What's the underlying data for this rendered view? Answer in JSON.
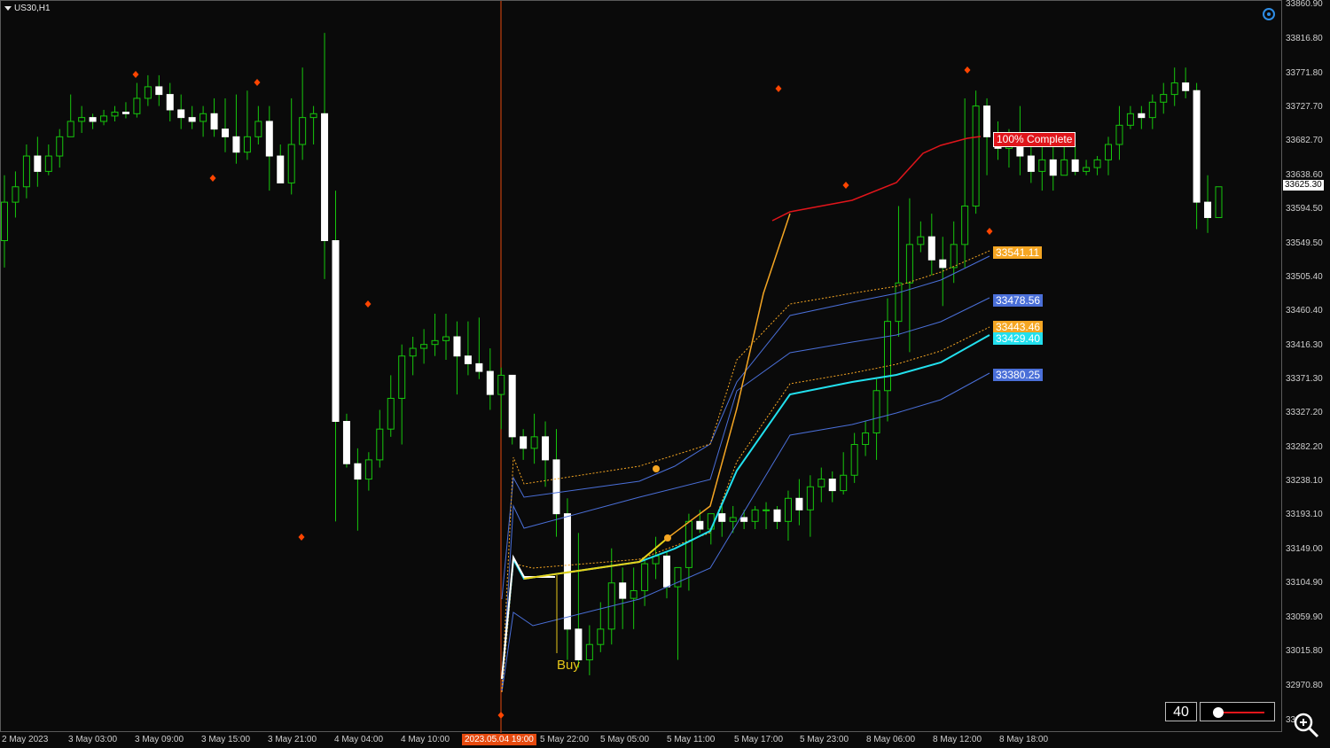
{
  "chart": {
    "symbol": "US30,H1",
    "current_price": "33625.30",
    "price_labels": [
      "33860.90",
      "33816.80",
      "33771.80",
      "33727.70",
      "33682.70",
      "33638.60",
      "33594.50",
      "33549.50",
      "33505.40",
      "33460.40",
      "33416.30",
      "33371.30",
      "33327.20",
      "33282.20",
      "33238.10",
      "33193.10",
      "33149.00",
      "33104.90",
      "33059.90",
      "33015.80",
      "32970.80",
      "33"
    ],
    "time_labels": [
      "2 May 2023",
      "3 May 03:00",
      "3 May 09:00",
      "3 May 15:00",
      "3 May 21:00",
      "4 May 04:00",
      "4 May 10:00",
      "5 May 22:00",
      "5 May 05:00",
      "5 May 11:00",
      "5 May 17:00",
      "5 May 23:00",
      "8 May 06:00",
      "8 May 12:00",
      "8 May 18:00"
    ],
    "highlighted_date": "2023.05.04 19:00",
    "complete_label": "100% Complete",
    "buy_label": "Buy",
    "levels": [
      {
        "value": "33541.11",
        "bg": "#f5a623",
        "fg": "#ffffff"
      },
      {
        "value": "33478.56",
        "bg": "#4a6fd8",
        "fg": "#ffffff"
      },
      {
        "value": "33443.46",
        "bg": "#f5a623",
        "fg": "#ffffff"
      },
      {
        "value": "33429.40",
        "bg": "#22e0ee",
        "fg": "#ffffff"
      },
      {
        "value": "33380.25",
        "bg": "#4a6fd8",
        "fg": "#ffffff"
      }
    ],
    "period_value": "40",
    "colors": {
      "bull": "#16c60c",
      "bear": "#ffffff",
      "vwap": "#22e0ee",
      "band": "#4a6fd8",
      "band_orange": "#f5a623",
      "complete": "#e0151b",
      "marker": "#ff4500"
    }
  },
  "chart_data": {
    "type": "candlestick",
    "title": "US30,H1",
    "ylim": [
      32930,
      33870
    ],
    "candles": [
      [
        33555,
        33605,
        33520,
        33640
      ],
      [
        33605,
        33625,
        33585,
        33645
      ],
      [
        33625,
        33665,
        33610,
        33680
      ],
      [
        33665,
        33645,
        33625,
        33690
      ],
      [
        33645,
        33665,
        33640,
        33680
      ],
      [
        33665,
        33690,
        33650,
        33700
      ],
      [
        33690,
        33710,
        33690,
        33745
      ],
      [
        33710,
        33715,
        33695,
        33730
      ],
      [
        33715,
        33710,
        33700,
        33720
      ],
      [
        33710,
        33717,
        33705,
        33725
      ],
      [
        33717,
        33722,
        33710,
        33730
      ],
      [
        33722,
        33720,
        33714,
        33735
      ],
      [
        33720,
        33740,
        33715,
        33760
      ],
      [
        33740,
        33755,
        33730,
        33770
      ],
      [
        33755,
        33745,
        33730,
        33770
      ],
      [
        33745,
        33725,
        33710,
        33760
      ],
      [
        33725,
        33715,
        33700,
        33745
      ],
      [
        33715,
        33710,
        33700,
        33730
      ],
      [
        33710,
        33720,
        33690,
        33730
      ],
      [
        33720,
        33700,
        33690,
        33740
      ],
      [
        33700,
        33690,
        33670,
        33740
      ],
      [
        33690,
        33670,
        33655,
        33745
      ],
      [
        33670,
        33690,
        33660,
        33750
      ],
      [
        33690,
        33710,
        33680,
        33730
      ],
      [
        33710,
        33665,
        33620,
        33730
      ],
      [
        33665,
        33630,
        33630,
        33680
      ],
      [
        33630,
        33680,
        33615,
        33740
      ],
      [
        33680,
        33715,
        33660,
        33780
      ],
      [
        33715,
        33720,
        33680,
        33730
      ],
      [
        33720,
        33555,
        33505,
        33825
      ],
      [
        33555,
        33320,
        33190,
        33620
      ],
      [
        33320,
        33265,
        33260,
        33330
      ],
      [
        33265,
        33245,
        33178,
        33285
      ],
      [
        33245,
        33270,
        33230,
        33280
      ],
      [
        33270,
        33310,
        33260,
        33335
      ],
      [
        33310,
        33350,
        33300,
        33380
      ],
      [
        33350,
        33405,
        33290,
        33420
      ],
      [
        33405,
        33415,
        33380,
        33430
      ],
      [
        33415,
        33420,
        33395,
        33440
      ],
      [
        33420,
        33425,
        33405,
        33460
      ],
      [
        33425,
        33430,
        33400,
        33460
      ],
      [
        33430,
        33405,
        33355,
        33450
      ],
      [
        33405,
        33395,
        33380,
        33450
      ],
      [
        33395,
        33385,
        33375,
        33455
      ],
      [
        33385,
        33355,
        33335,
        33415
      ],
      [
        33355,
        33380,
        33310,
        33390
      ],
      [
        33380,
        33300,
        33290,
        33360
      ],
      [
        33300,
        33285,
        33270,
        33310
      ],
      [
        33285,
        33300,
        33265,
        33330
      ],
      [
        33300,
        33270,
        33235,
        33320
      ],
      [
        33270,
        33200,
        33170,
        33310
      ],
      [
        33200,
        33050,
        33010,
        33220
      ],
      [
        33050,
        33010,
        33000,
        33175
      ],
      [
        33010,
        33030,
        32990,
        33055
      ],
      [
        33030,
        33050,
        33020,
        33085
      ],
      [
        33050,
        33110,
        33030,
        33155
      ],
      [
        33110,
        33090,
        33050,
        33130
      ],
      [
        33090,
        33100,
        33050,
        33130
      ],
      [
        33100,
        33135,
        33080,
        33140
      ],
      [
        33135,
        33145,
        33115,
        33170
      ],
      [
        33145,
        33105,
        33090,
        33150
      ],
      [
        33105,
        33130,
        33010,
        33130
      ],
      [
        33130,
        33190,
        33100,
        33200
      ],
      [
        33190,
        33180,
        33175,
        33205
      ],
      [
        33180,
        33200,
        33160,
        33200
      ],
      [
        33200,
        33190,
        33170,
        33210
      ],
      [
        33190,
        33195,
        33175,
        33210
      ],
      [
        33195,
        33190,
        33180,
        33205
      ],
      [
        33190,
        33205,
        33180,
        33210
      ],
      [
        33205,
        33205,
        33180,
        33215
      ],
      [
        33205,
        33190,
        33180,
        33210
      ],
      [
        33190,
        33220,
        33165,
        33230
      ],
      [
        33220,
        33205,
        33185,
        33245
      ],
      [
        33205,
        33235,
        33170,
        33250
      ],
      [
        33235,
        33245,
        33215,
        33260
      ],
      [
        33245,
        33230,
        33215,
        33255
      ],
      [
        33230,
        33250,
        33225,
        33280
      ],
      [
        33250,
        33290,
        33240,
        33305
      ],
      [
        33290,
        33305,
        33275,
        33320
      ],
      [
        33305,
        33360,
        33270,
        33375
      ],
      [
        33360,
        33450,
        33320,
        33480
      ],
      [
        33450,
        33500,
        33430,
        33600
      ],
      [
        33500,
        33550,
        33410,
        33610
      ],
      [
        33550,
        33560,
        33540,
        33580
      ],
      [
        33560,
        33530,
        33510,
        33590
      ],
      [
        33530,
        33520,
        33470,
        33560
      ],
      [
        33520,
        33550,
        33500,
        33580
      ],
      [
        33550,
        33600,
        33520,
        33740
      ],
      [
        33600,
        33730,
        33590,
        33750
      ],
      [
        33730,
        33690,
        33640,
        33740
      ],
      [
        33690,
        33675,
        33660,
        33710
      ],
      [
        33675,
        33695,
        33650,
        33700
      ],
      [
        33695,
        33665,
        33640,
        33730
      ],
      [
        33665,
        33645,
        33630,
        33680
      ],
      [
        33645,
        33660,
        33620,
        33680
      ],
      [
        33660,
        33640,
        33620,
        33680
      ],
      [
        33640,
        33660,
        33640,
        33680
      ],
      [
        33660,
        33645,
        33640,
        33680
      ],
      [
        33645,
        33650,
        33640,
        33660
      ],
      [
        33650,
        33660,
        33640,
        33665
      ],
      [
        33660,
        33680,
        33640,
        33690
      ],
      [
        33680,
        33705,
        33660,
        33730
      ],
      [
        33705,
        33720,
        33700,
        33730
      ],
      [
        33720,
        33715,
        33700,
        33730
      ],
      [
        33715,
        33735,
        33700,
        33745
      ],
      [
        33735,
        33745,
        33720,
        33760
      ],
      [
        33745,
        33760,
        33730,
        33780
      ],
      [
        33760,
        33750,
        33740,
        33780
      ],
      [
        33750,
        33605,
        33570,
        33760
      ],
      [
        33605,
        33585,
        33565,
        33640
      ],
      [
        33585,
        33625,
        33585,
        33625
      ]
    ],
    "vwap": [
      [
        565,
        33000
      ],
      [
        578,
        33149
      ],
      [
        595,
        33130
      ],
      [
        720,
        33150
      ],
      [
        800,
        33200
      ],
      [
        890,
        33400
      ],
      [
        1010,
        33450
      ],
      [
        1060,
        33480
      ],
      [
        1115,
        33429.4
      ]
    ],
    "levels": [
      33541.11,
      33478.56,
      33443.46,
      33429.4,
      33380.25
    ]
  }
}
